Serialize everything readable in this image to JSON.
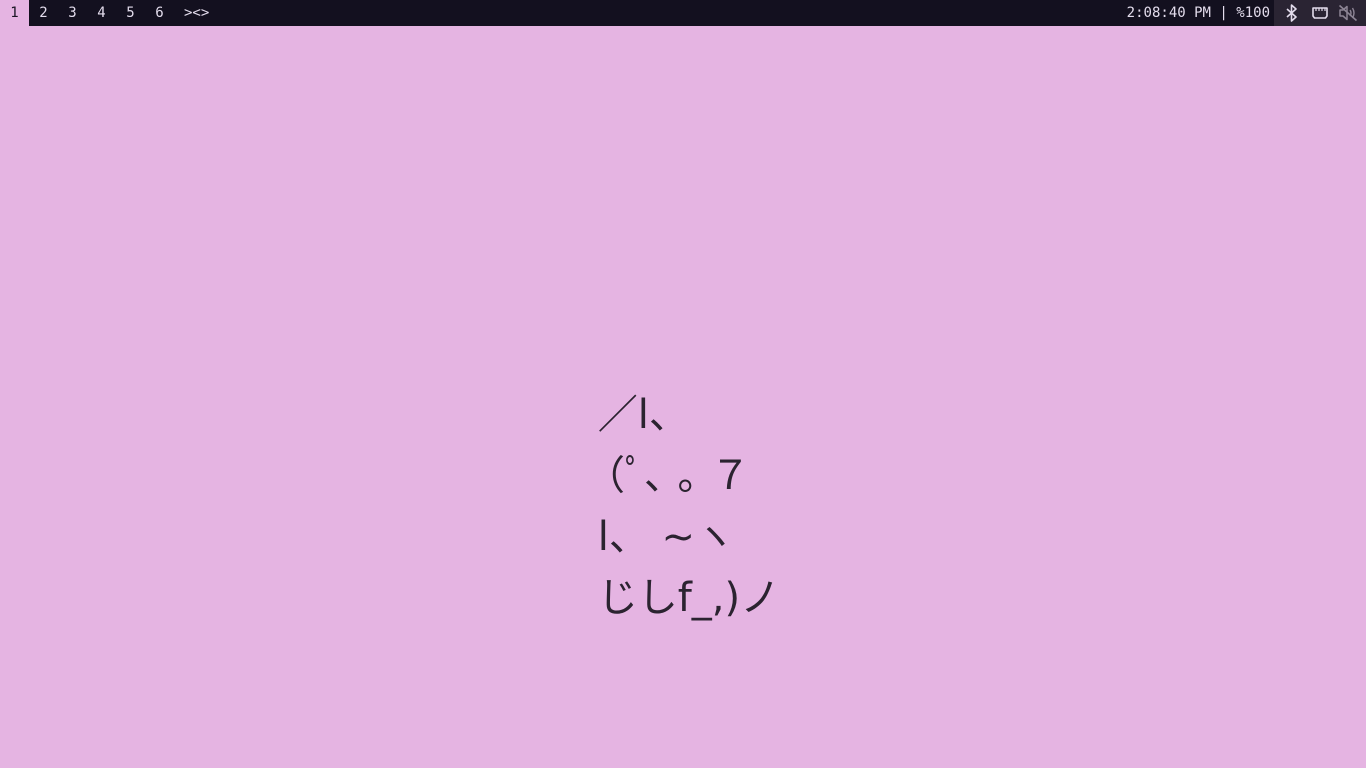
{
  "topbar": {
    "workspaces": [
      {
        "label": "1",
        "active": true
      },
      {
        "label": "2",
        "active": false
      },
      {
        "label": "3",
        "active": false
      },
      {
        "label": "4",
        "active": false
      },
      {
        "label": "5",
        "active": false
      },
      {
        "label": "6",
        "active": false
      }
    ],
    "layout_indicator": "><>",
    "clock": "2:08:40 PM",
    "separator": "|",
    "volume": "%100",
    "tray_icons": [
      "bluetooth-icon",
      "network-ethernet-icon",
      "volume-muted-icon"
    ]
  },
  "desktop": {
    "background_color": "#e5b4e2",
    "ascii_art_lines": [
      " ／l、",
      "（ﾟ､ ｡ ７",
      " l、 ~ヽ",
      " じしf_,)ノ"
    ]
  }
}
